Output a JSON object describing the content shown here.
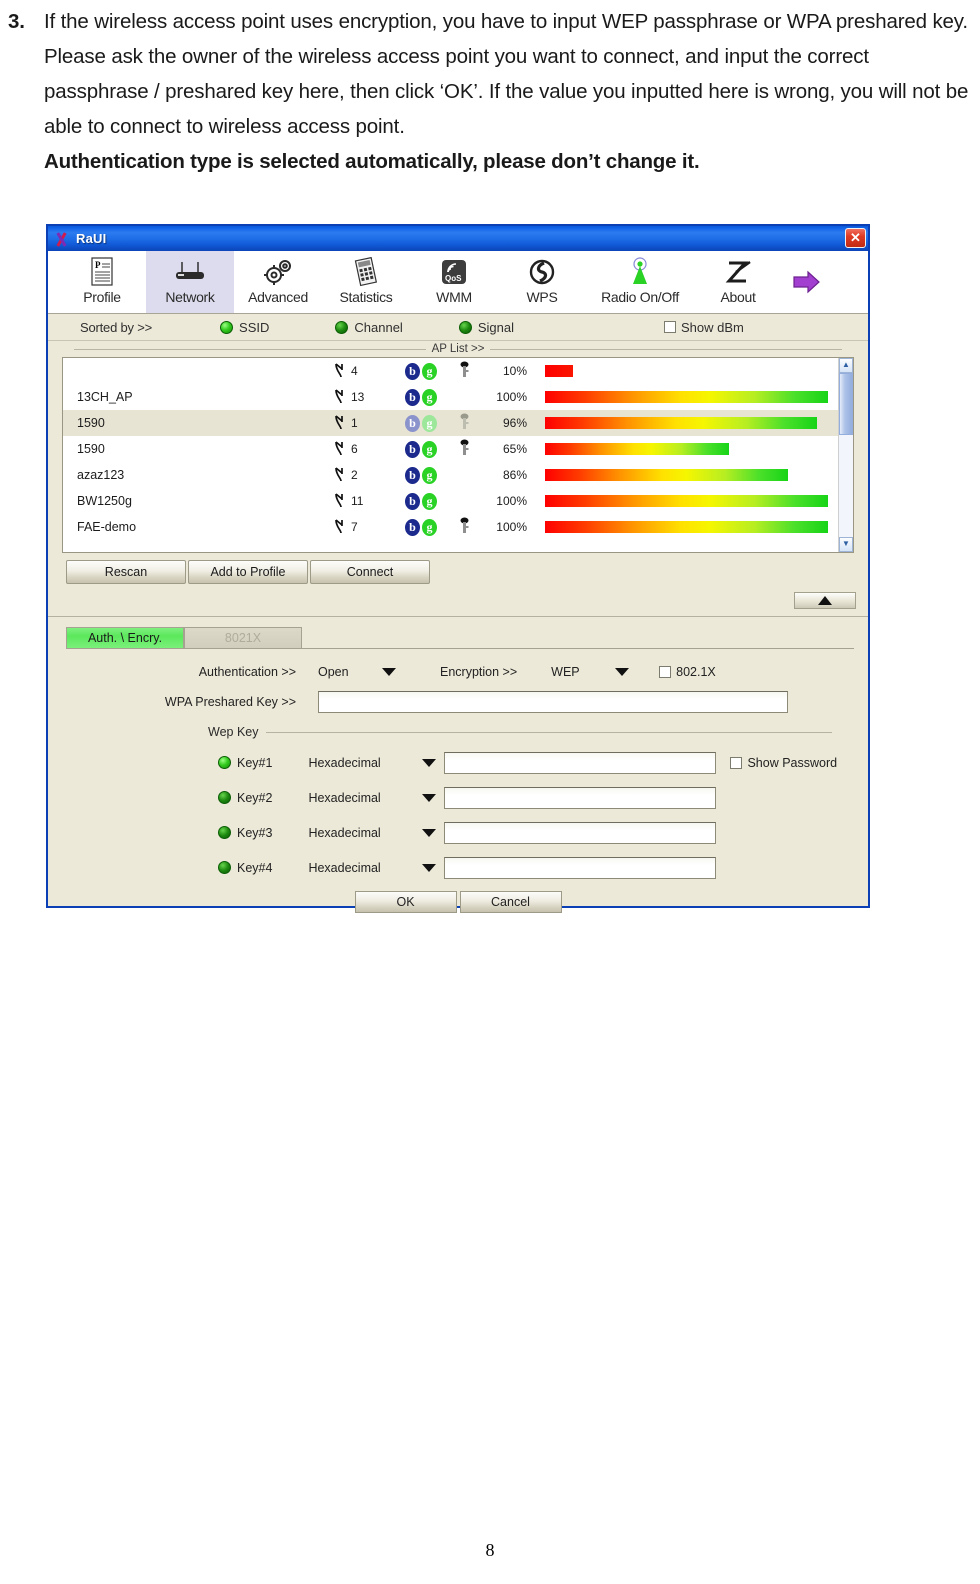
{
  "document": {
    "item_number": "3.",
    "paragraph": "If the wireless access point uses encryption, you have to input WEP passphrase or WPA preshared key. Please ask the owner of the wireless access point you want to connect, and input the correct passphrase / preshared key here, then click ‘OK’. If the value you inputted here is wrong, you will not be able to connect to wireless access point.",
    "bold_note": "Authentication type is selected automatically, please don’t change it.",
    "page_number": "8"
  },
  "window": {
    "title": "RaUI",
    "close_label": "✕",
    "logo_name": "ralink-logo"
  },
  "toolbar": {
    "items": [
      {
        "label": "Profile",
        "icon": "profile-document-icon",
        "active": false
      },
      {
        "label": "Network",
        "icon": "network-router-icon",
        "active": true
      },
      {
        "label": "Advanced",
        "icon": "advanced-gears-icon",
        "active": false
      },
      {
        "label": "Statistics",
        "icon": "statistics-calculator-icon",
        "active": false
      },
      {
        "label": "WMM",
        "icon": "wmm-qos-icon",
        "active": false
      },
      {
        "label": "WPS",
        "icon": "wps-icon",
        "active": false
      },
      {
        "label": "Radio On/Off",
        "icon": "radio-antenna-icon",
        "active": false
      },
      {
        "label": "About",
        "icon": "about-icon",
        "active": false
      }
    ],
    "expand_arrow": "expand-arrow-icon"
  },
  "sortbar": {
    "label": "Sorted by >>",
    "options": [
      {
        "label": "SSID",
        "selected": true
      },
      {
        "label": "Channel",
        "selected": false
      },
      {
        "label": "Signal",
        "selected": false
      }
    ],
    "show_dbm": {
      "label": "Show dBm",
      "checked": false
    }
  },
  "ap_list": {
    "legend": "AP List >>",
    "rows": [
      {
        "ssid": "",
        "channel": "4",
        "b": "b",
        "g": "g",
        "secured": true,
        "signal": "10%",
        "signal_pct": 10,
        "selected": false
      },
      {
        "ssid": "13CH_AP",
        "channel": "13",
        "b": "b",
        "g": "g",
        "secured": false,
        "signal": "100%",
        "signal_pct": 100,
        "selected": false
      },
      {
        "ssid": "1590",
        "channel": "1",
        "b": "b",
        "g": "g",
        "secured": true,
        "signal": "96%",
        "signal_pct": 96,
        "selected": true
      },
      {
        "ssid": "1590",
        "channel": "6",
        "b": "b",
        "g": "g",
        "secured": true,
        "signal": "65%",
        "signal_pct": 65,
        "selected": false
      },
      {
        "ssid": "azaz123",
        "channel": "2",
        "b": "b",
        "g": "g",
        "secured": false,
        "signal": "86%",
        "signal_pct": 86,
        "selected": false
      },
      {
        "ssid": "BW1250g",
        "channel": "11",
        "b": "b",
        "g": "g",
        "secured": false,
        "signal": "100%",
        "signal_pct": 100,
        "selected": false
      },
      {
        "ssid": "FAE-demo",
        "channel": "7",
        "b": "b",
        "g": "g",
        "secured": true,
        "signal": "100%",
        "signal_pct": 100,
        "selected": false
      }
    ]
  },
  "actions": {
    "rescan": "Rescan",
    "add_to_profile": "Add to Profile",
    "connect": "Connect",
    "collapse": "collapse-arrow-icon"
  },
  "tabs": [
    {
      "label": "Auth. \\ Encry.",
      "active": true
    },
    {
      "label": "8021X",
      "active": false
    }
  ],
  "auth_form": {
    "authentication_label": "Authentication >>",
    "authentication_value": "Open",
    "encryption_label": "Encryption >>",
    "encryption_value": "WEP",
    "dot1x": {
      "label": "802.1X",
      "checked": false
    },
    "wpa_psk_label": "WPA Preshared Key >>",
    "wpa_psk_value": "",
    "wep_group_label": "Wep Key",
    "show_password": {
      "label": "Show Password",
      "checked": false
    },
    "keys": [
      {
        "label": "Key#1",
        "format": "Hexadecimal",
        "value": "",
        "selected": true
      },
      {
        "label": "Key#2",
        "format": "Hexadecimal",
        "value": "",
        "selected": false
      },
      {
        "label": "Key#3",
        "format": "Hexadecimal",
        "value": "",
        "selected": false
      },
      {
        "label": "Key#4",
        "format": "Hexadecimal",
        "value": "",
        "selected": false
      }
    ],
    "ok": "OK",
    "cancel": "Cancel"
  },
  "colors": {
    "titlebar_blue": "#1f6ee8",
    "window_face": "#ece9d8",
    "active_tab_green": "#5ce85c",
    "close_red": "#c12b12",
    "signal_start": "#ff0000",
    "signal_end": "#17d417"
  }
}
